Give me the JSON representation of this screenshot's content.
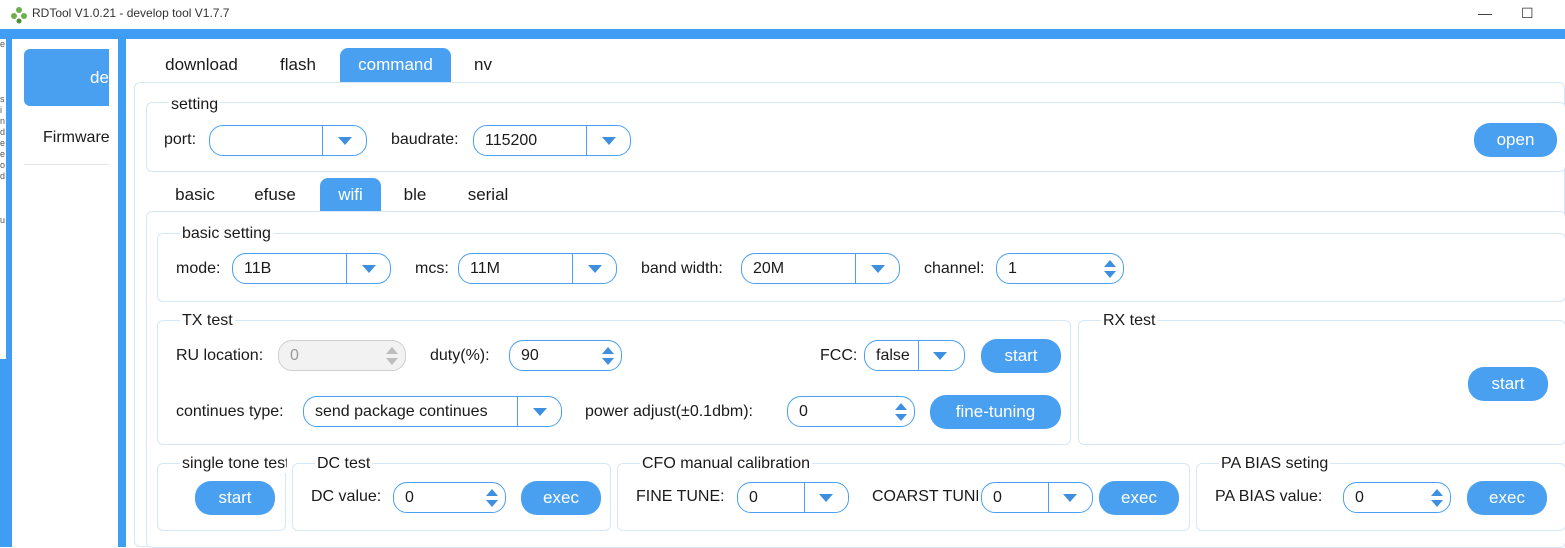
{
  "window": {
    "title": "RDTool V1.0.21 - develop tool V1.7.7",
    "minimize": "—",
    "maximize": "☐"
  },
  "leftstrip": [
    "e",
    "",
    "",
    "",
    "",
    "s",
    "i",
    "n",
    "d",
    "e",
    "e",
    "o",
    "d",
    "",
    "",
    "",
    "u"
  ],
  "sidebar": {
    "active_label": "develop",
    "item_label": "Firmware"
  },
  "tabs": [
    "download",
    "flash",
    "command",
    "nv"
  ],
  "setting": {
    "title": "setting",
    "port_label": "port:",
    "port_value": "",
    "baud_label": "baudrate:",
    "baud_value": "115200",
    "open": "open"
  },
  "subtabs": [
    "basic",
    "efuse",
    "wifi",
    "ble",
    "serial"
  ],
  "basic_setting": {
    "title": "basic setting",
    "mode_label": "mode:",
    "mode_value": "11B",
    "mcs_label": "mcs:",
    "mcs_value": "11M",
    "bw_label": "band width:",
    "bw_value": "20M",
    "channel_label": "channel:",
    "channel_value": "1"
  },
  "tx": {
    "title": "TX test",
    "ru_label": "RU location:",
    "ru_value": "0",
    "duty_label": "duty(%):",
    "duty_value": "90",
    "fcc_label": "FCC:",
    "fcc_value": "false",
    "start": "start",
    "ct_label": "continues type:",
    "ct_value": "send package continues",
    "pa_label": "power adjust(±0.1dbm):",
    "pa_value": "0",
    "fine": "fine-tuning"
  },
  "rx": {
    "title": "RX test",
    "start": "start"
  },
  "single_tone": {
    "title": "single tone test",
    "start": "start"
  },
  "dc": {
    "title": "DC test",
    "label": "DC value:",
    "value": "0",
    "exec": "exec"
  },
  "cfo": {
    "title": "CFO manual calibration",
    "fine_label": "FINE TUNE:",
    "fine_value": "0",
    "coarse_label": "COARST TUNE:",
    "coarse_value": "0",
    "exec": "exec"
  },
  "pa_bias": {
    "title": "PA BIAS seting",
    "label": "PA BIAS value:",
    "value": "0",
    "exec": "exec"
  },
  "colors": {
    "accent": "#4aa0f0",
    "frame": "#3f9df4",
    "border": "#d6e8f7"
  }
}
